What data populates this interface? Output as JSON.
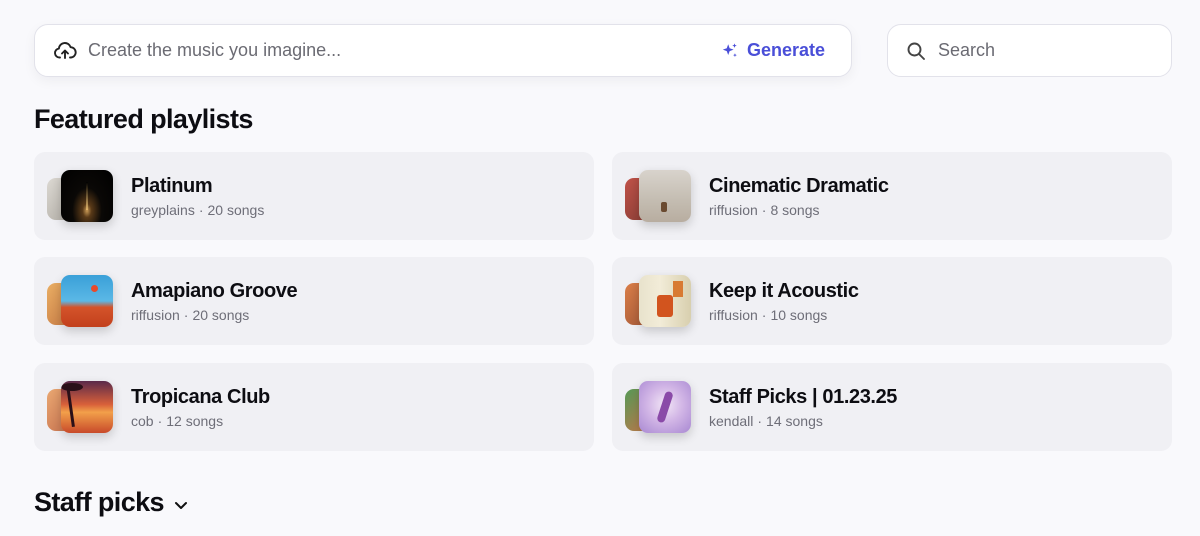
{
  "create": {
    "placeholder": "Create the music you imagine...",
    "upload_icon": "cloud-upload-icon",
    "generate_label": "Generate",
    "generate_icon": "sparkle-icon",
    "accent_color": "#4a4fd8"
  },
  "search": {
    "placeholder": "Search",
    "icon": "search-icon"
  },
  "featured": {
    "title": "Featured playlists",
    "playlists": [
      {
        "title": "Platinum",
        "author": "greyplains",
        "count": "20 songs"
      },
      {
        "title": "Cinematic Dramatic",
        "author": "riffusion",
        "count": "8 songs"
      },
      {
        "title": "Amapiano Groove",
        "author": "riffusion",
        "count": "20 songs"
      },
      {
        "title": "Keep it Acoustic",
        "author": "riffusion",
        "count": "10 songs"
      },
      {
        "title": "Tropicana Club",
        "author": "cob",
        "count": "12 songs"
      },
      {
        "title": "Staff Picks | 01.23.25",
        "author": "kendall",
        "count": "14 songs"
      }
    ]
  },
  "staff_picks": {
    "title": "Staff picks",
    "icon": "chevron-down-icon"
  }
}
